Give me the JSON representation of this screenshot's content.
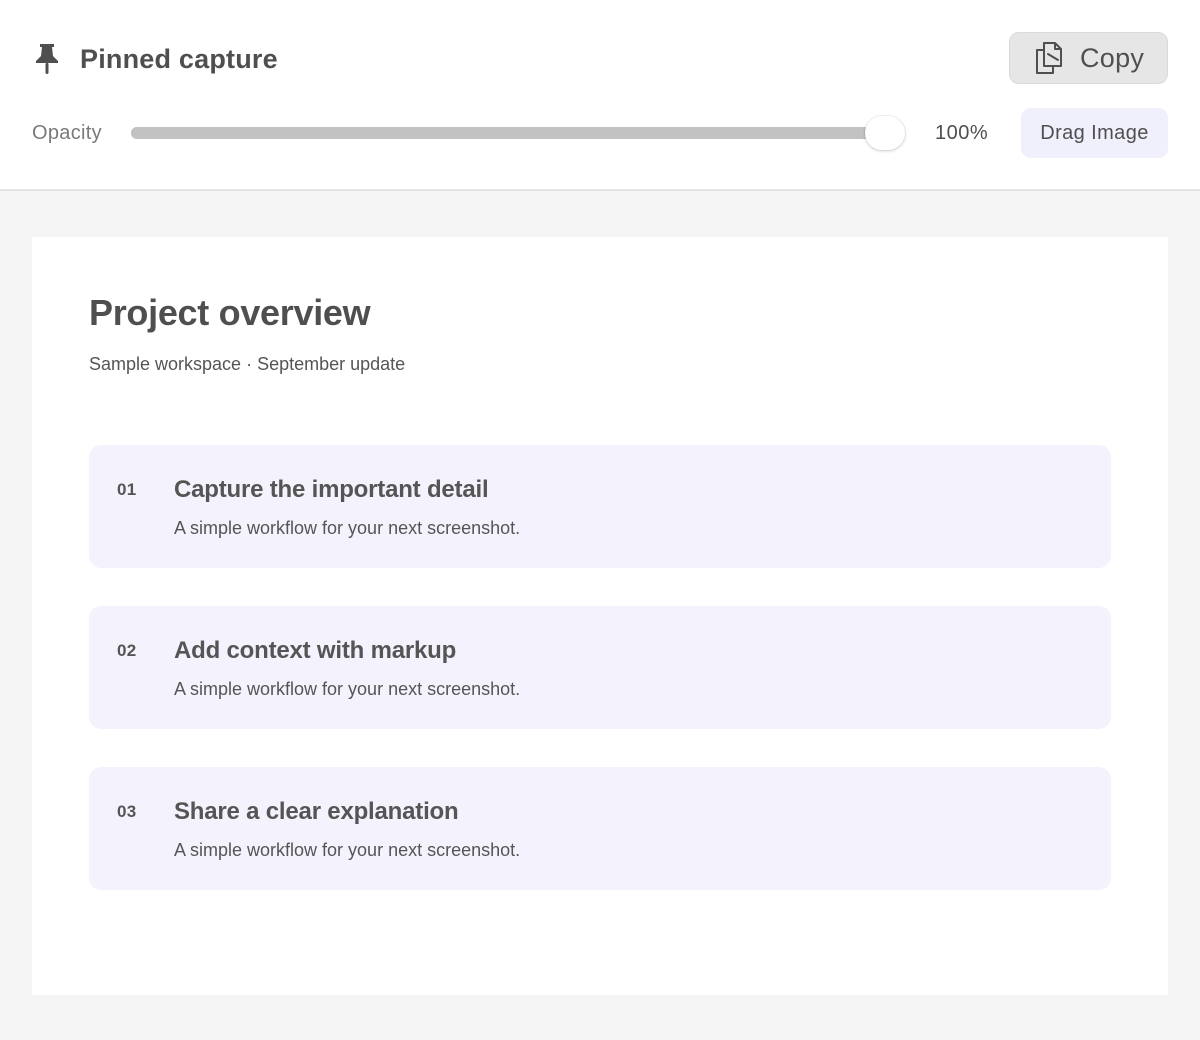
{
  "header": {
    "title": "Pinned capture",
    "copy_label": "Copy",
    "opacity_label": "Opacity",
    "opacity_value": "100%",
    "opacity_percent": 100,
    "drag_label": "Drag Image"
  },
  "icons": {
    "pin": "pin-icon",
    "copy": "copy-icon"
  },
  "document": {
    "title": "Project overview",
    "subtitle": "Sample workspace · September update",
    "items": [
      {
        "number": "01",
        "title": "Capture the important detail",
        "description": "A simple workflow for your next screenshot."
      },
      {
        "number": "02",
        "title": "Add context with markup",
        "description": "A simple workflow for your next screenshot."
      },
      {
        "number": "03",
        "title": "Share a clear explanation",
        "description": "A simple workflow for your next screenshot."
      }
    ]
  },
  "colors": {
    "toolbar_bg": "#ffffff",
    "window_bg": "#f5f5f5",
    "card_bg": "#f4f3fd",
    "drag_button_bg": "#f0effc",
    "copy_button_bg": "#e6e6e6",
    "slider_track": "#c2c2c2",
    "text": "#4f4f4f"
  }
}
